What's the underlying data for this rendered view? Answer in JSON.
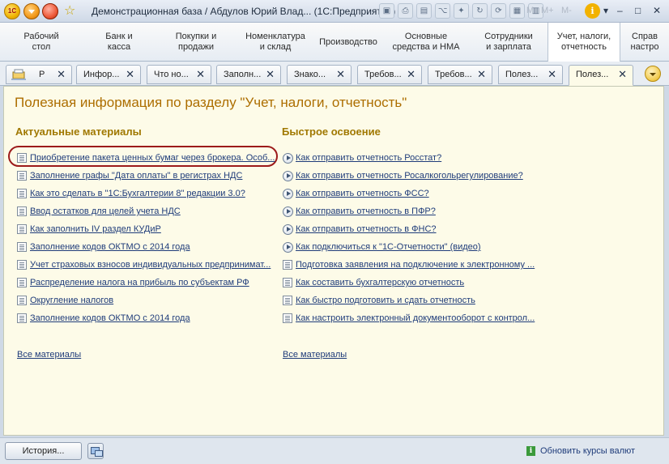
{
  "window": {
    "title": "Демонстрационная база / Абдулов Юрий Влад...  (1С:Предприятие)",
    "logo_text": "1С",
    "m_buttons": [
      "M",
      "M+",
      "M-"
    ]
  },
  "sections": [
    {
      "label": "Рабочий\nстол"
    },
    {
      "label": "Банк и\nкасса"
    },
    {
      "label": "Покупки и\nпродажи"
    },
    {
      "label": "Номенклатура\nи склад"
    },
    {
      "label": "Производство"
    },
    {
      "label": "Основные\nсредства и НМА"
    },
    {
      "label": "Сотрудники\nи зарплата"
    },
    {
      "label": "Учет, налоги,\nотчетность"
    },
    {
      "label": "Справ\nнастро"
    }
  ],
  "tabs": [
    {
      "label": "Р"
    },
    {
      "label": "Инфор..."
    },
    {
      "label": "Что но..."
    },
    {
      "label": "Заполн..."
    },
    {
      "label": "Знако..."
    },
    {
      "label": "Требов..."
    },
    {
      "label": "Требов..."
    },
    {
      "label": "Полез..."
    },
    {
      "label": "Полез..."
    }
  ],
  "content": {
    "page_title": "Полезная информация по разделу \"Учет, налоги, отчетность\"",
    "left_column": {
      "title": "Актуальные материалы",
      "items": [
        "Приобретение пакета ценных бумаг через брокера. Особ...",
        "Заполнение графы \"Дата оплаты\"  в регистрах НДС",
        "Как это сделать в \"1С:Бухгалтерии 8\" редакции 3.0?",
        "Ввод остатков для целей учета НДС",
        "Как заполнить IV раздел КУДиР",
        "Заполнение кодов ОКТМО с 2014 года",
        "Учет страховых взносов индивидуальных предпринимат...",
        "Распределение налога на прибыль по субъектам РФ",
        "Округление налогов",
        "Заполнение кодов ОКТМО с 2014 года"
      ],
      "all_link": "Все материалы"
    },
    "right_column": {
      "title": "Быстрое освоение",
      "items": [
        {
          "label": "Как отправить отчетность Росстат?",
          "icon": "play-video-icon"
        },
        {
          "label": "Как отправить отчетность Росалкогольрегулирование?",
          "icon": "play-video-icon"
        },
        {
          "label": "Как отправить отчетность ФСС?",
          "icon": "play-video-icon"
        },
        {
          "label": "Как отправить отчетность в ПФР?",
          "icon": "play-video-icon"
        },
        {
          "label": "Как отправить отчетность в ФНС?",
          "icon": "play-video-icon"
        },
        {
          "label": "Как подключиться к \"1С-Отчетности\" (видео)",
          "icon": "play-video-icon"
        },
        {
          "label": "Подготовка заявления на подключение к электронному ...",
          "icon": "document-icon"
        },
        {
          "label": "Как составить бухгалтерскую отчетность",
          "icon": "document-icon"
        },
        {
          "label": "Как быстро подготовить и сдать отчетность",
          "icon": "document-icon"
        },
        {
          "label": "Как настроить электронный документооборот с контрол...",
          "icon": "document-icon"
        }
      ],
      "all_link": "Все материалы"
    }
  },
  "bottom": {
    "history_label": "История...",
    "status_text": "Обновить курсы валют"
  },
  "colors": {
    "accent_title": "#ad6e00",
    "column_title": "#a07800",
    "link": "#1f3c7a",
    "highlight": "#9c1a1a",
    "content_bg": "#fdfbe8"
  }
}
